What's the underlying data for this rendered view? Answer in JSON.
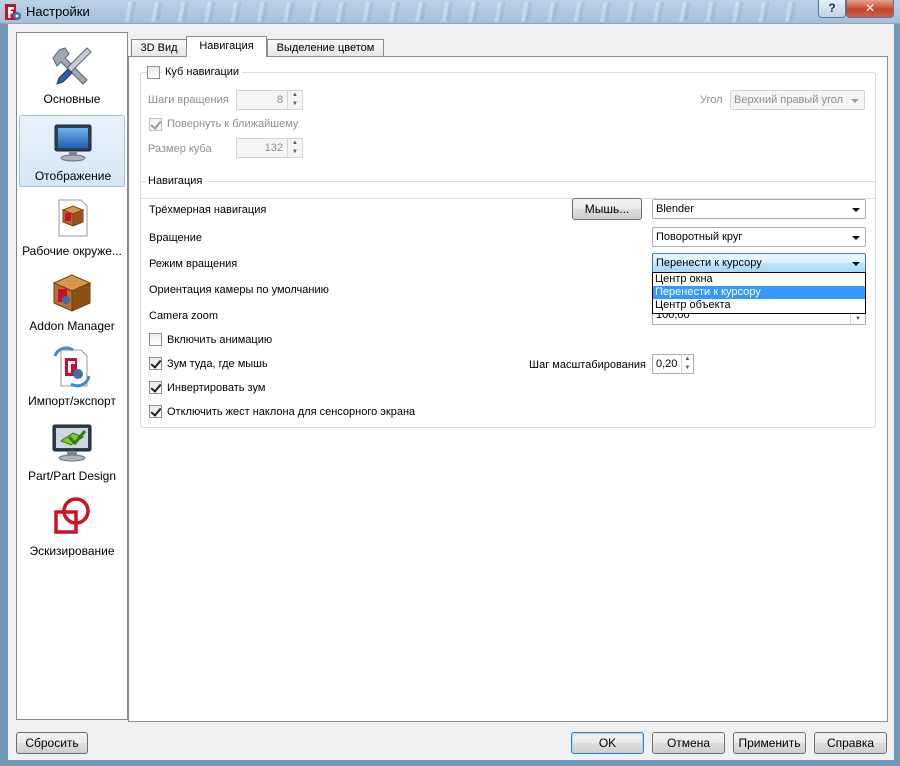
{
  "window": {
    "title": "Настройки",
    "help_label": "?",
    "close_label": "✕"
  },
  "sidebar": {
    "items": [
      {
        "label": "Основные",
        "icon": "wrench-screwdriver-icon"
      },
      {
        "label": "Отображение",
        "icon": "monitor-icon",
        "selected": true
      },
      {
        "label": "Рабочие окруже...",
        "icon": "workbench-box-icon"
      },
      {
        "label": "Addon Manager",
        "icon": "addon-box-icon"
      },
      {
        "label": "Импорт/экспорт",
        "icon": "import-export-icon"
      },
      {
        "label": "Part/Part Design",
        "icon": "part-design-icon"
      },
      {
        "label": "Эскизирование",
        "icon": "sketcher-icon"
      }
    ]
  },
  "tabs": [
    {
      "label": "3D Вид"
    },
    {
      "label": "Навигация",
      "active": true
    },
    {
      "label": "Выделение цветом"
    }
  ],
  "navcube": {
    "title": "Куб навигации",
    "checked": false,
    "steps_label": "Шаги вращения",
    "steps_value": "8",
    "snap_label": "Повернуть к ближайшему",
    "snap_checked": true,
    "size_label": "Размер куба",
    "size_value": "132",
    "corner_label": "Угол",
    "corner_value": "Верхний правый угол"
  },
  "navigation": {
    "title": "Навигация",
    "nav3d_label": "Трёхмерная навигация",
    "mouse_button": "Мышь...",
    "nav3d_value": "Blender",
    "rotation_label": "Вращение",
    "rotation_value": "Поворотный круг",
    "rotmode_label": "Режим вращения",
    "rotmode_value": "Перенести к курсору",
    "rotmode_options": [
      "Центр окна",
      "Перенести к курсору",
      "Центр объекта"
    ],
    "rotmode_highlighted": 1,
    "orientation_label": "Ориентация камеры по умолчанию",
    "camzoom_label": "Camera zoom",
    "camzoom_value": "100,00",
    "anim_label": "Включить анимацию",
    "anim_checked": false,
    "zoomcursor_label": "Зум туда, где мышь",
    "zoomcursor_checked": true,
    "zoomstep_label": "Шаг масштабирования",
    "zoomstep_value": "0,20",
    "invert_label": "Инвертировать зум",
    "invert_checked": true,
    "tilt_label": "Отключить жест наклона для сенсорного экрана",
    "tilt_checked": true
  },
  "footer": {
    "reset": "Сбросить",
    "ok": "OK",
    "cancel": "Отмена",
    "apply": "Применить",
    "help": "Справка"
  }
}
